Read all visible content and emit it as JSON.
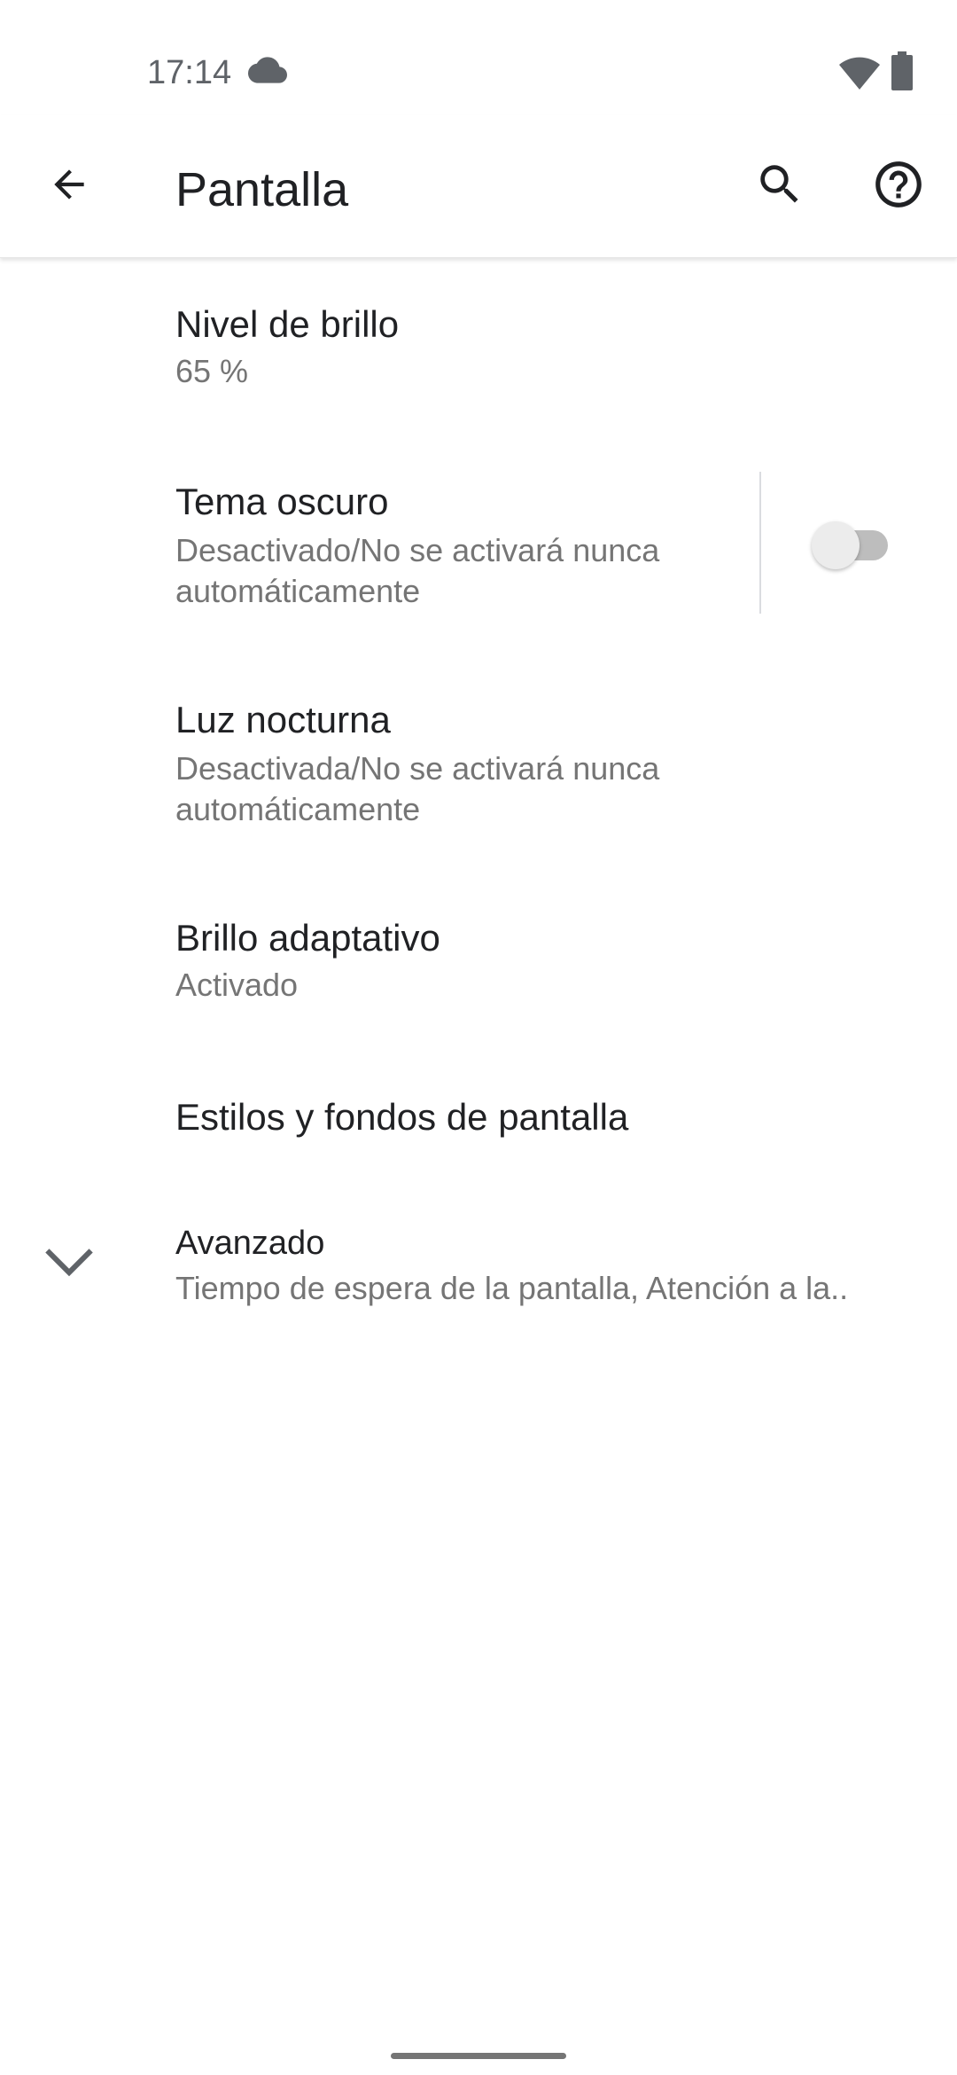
{
  "status_bar": {
    "time": "17:14",
    "icons": [
      "cloud-icon",
      "wifi-icon",
      "battery-icon"
    ]
  },
  "app_bar": {
    "title": "Pantalla",
    "icons": [
      "back-arrow-icon",
      "search-icon",
      "help-icon"
    ]
  },
  "settings": {
    "brightness": {
      "title": "Nivel de brillo",
      "summary": "65 %"
    },
    "dark_theme": {
      "title": "Tema oscuro",
      "summary_line1": "Desactivado/No se activará nunca",
      "summary_line2": "automáticamente",
      "switch_state": "off"
    },
    "night_light": {
      "title": "Luz nocturna",
      "summary_line1": "Desactivada/No se activará nunca",
      "summary_line2": "automáticamente"
    },
    "adaptive_brightness": {
      "title": "Brillo adaptativo",
      "summary": "Activado"
    },
    "styles": {
      "title": "Estilos y fondos de pantalla"
    },
    "advanced": {
      "title": "Avanzado",
      "summary": "Tiempo de espera de la pantalla, Atención a la..",
      "icon": "chevron-down-icon"
    }
  },
  "colors": {
    "primary_text": "#202124",
    "secondary_text": "#757575",
    "icon": "#202124",
    "switch_track_off": "#bdbdbd",
    "switch_thumb_off": "#ececec"
  }
}
